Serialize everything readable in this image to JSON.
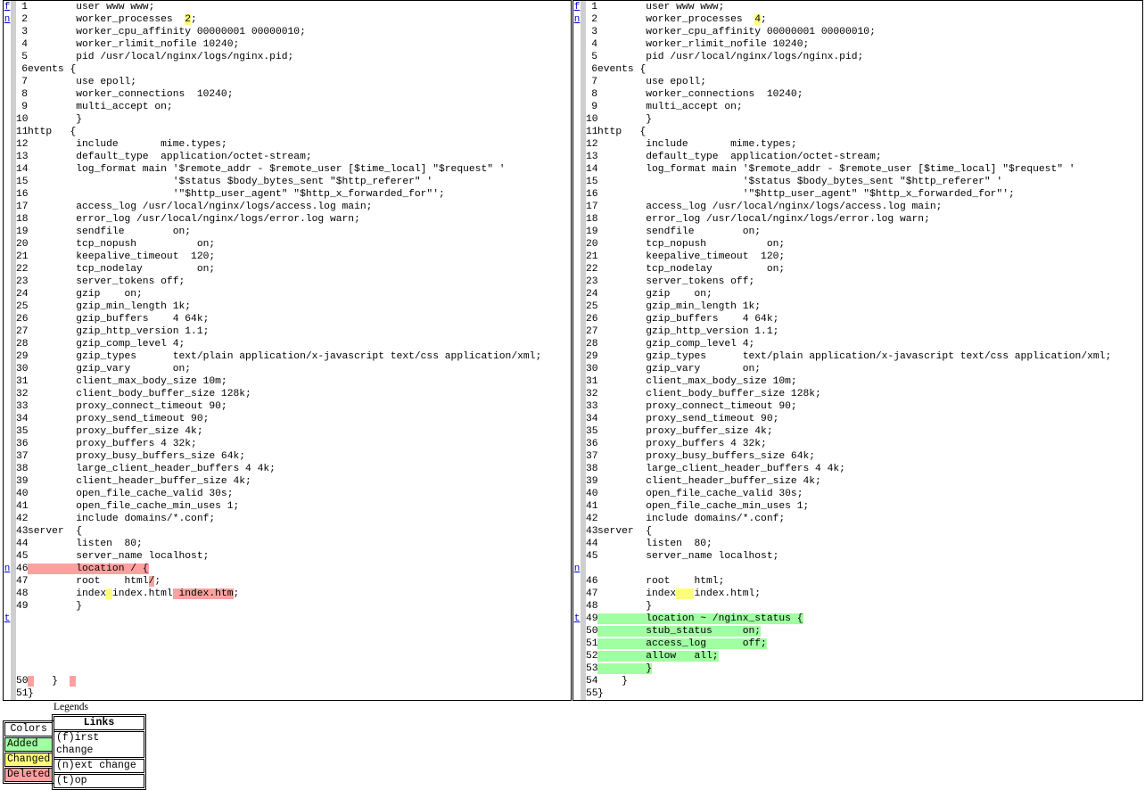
{
  "colors": {
    "added": "#a0ffa0",
    "changed": "#ffff77",
    "deleted": "#ffa0a0",
    "gutter": "#cfcfcf",
    "link": "#0000cc"
  },
  "left_pane": {
    "rows": [
      {
        "num": "1",
        "nav": "f",
        "segs": [
          {
            "t": "        user www www;"
          }
        ]
      },
      {
        "num": "2",
        "nav": "n",
        "segs": [
          {
            "t": "        worker_processes  "
          },
          {
            "t": "2",
            "k": "chg"
          },
          {
            "t": ";"
          }
        ]
      },
      {
        "num": "3",
        "segs": [
          {
            "t": "        worker_cpu_affinity 00000001 00000010;"
          }
        ]
      },
      {
        "num": "4",
        "segs": [
          {
            "t": "        worker_rlimit_nofile 10240;"
          }
        ]
      },
      {
        "num": "5",
        "segs": [
          {
            "t": "        pid /usr/local/nginx/logs/nginx.pid;"
          }
        ]
      },
      {
        "num": "6",
        "segs": [
          {
            "t": "events {"
          }
        ]
      },
      {
        "num": "7",
        "segs": [
          {
            "t": "        use epoll;"
          }
        ]
      },
      {
        "num": "8",
        "segs": [
          {
            "t": "        worker_connections  10240;"
          }
        ]
      },
      {
        "num": "9",
        "segs": [
          {
            "t": "        multi_accept on;"
          }
        ]
      },
      {
        "num": "10",
        "segs": [
          {
            "t": "        }"
          }
        ]
      },
      {
        "num": "11",
        "segs": [
          {
            "t": "http   {"
          }
        ]
      },
      {
        "num": "12",
        "segs": [
          {
            "t": "        include       mime.types;"
          }
        ]
      },
      {
        "num": "13",
        "segs": [
          {
            "t": "        default_type  application/octet-stream;"
          }
        ]
      },
      {
        "num": "14",
        "segs": [
          {
            "t": "        log_format main '$remote_addr - $remote_user [$time_local] \"$request\" '"
          }
        ]
      },
      {
        "num": "15",
        "segs": [
          {
            "t": "                        '$status $body_bytes_sent \"$http_referer\" '"
          }
        ]
      },
      {
        "num": "16",
        "segs": [
          {
            "t": "                        '\"$http_user_agent\" \"$http_x_forwarded_for\"';"
          }
        ]
      },
      {
        "num": "17",
        "segs": [
          {
            "t": "        access_log /usr/local/nginx/logs/access.log main;"
          }
        ]
      },
      {
        "num": "18",
        "segs": [
          {
            "t": "        error_log /usr/local/nginx/logs/error.log warn;"
          }
        ]
      },
      {
        "num": "19",
        "segs": [
          {
            "t": "        sendfile        on;"
          }
        ]
      },
      {
        "num": "20",
        "segs": [
          {
            "t": "        tcp_nopush          on;"
          }
        ]
      },
      {
        "num": "21",
        "segs": [
          {
            "t": "        keepalive_timeout  120;"
          }
        ]
      },
      {
        "num": "22",
        "segs": [
          {
            "t": "        tcp_nodelay         on;"
          }
        ]
      },
      {
        "num": "23",
        "segs": [
          {
            "t": "        server_tokens off;"
          }
        ]
      },
      {
        "num": "24",
        "segs": [
          {
            "t": "        gzip    on;"
          }
        ]
      },
      {
        "num": "25",
        "segs": [
          {
            "t": "        gzip_min_length 1k;"
          }
        ]
      },
      {
        "num": "26",
        "segs": [
          {
            "t": "        gzip_buffers    4 64k;"
          }
        ]
      },
      {
        "num": "27",
        "segs": [
          {
            "t": "        gzip_http_version 1.1;"
          }
        ]
      },
      {
        "num": "28",
        "segs": [
          {
            "t": "        gzip_comp_level 4;"
          }
        ]
      },
      {
        "num": "29",
        "segs": [
          {
            "t": "        gzip_types      text/plain application/x-javascript text/css application/xml;"
          }
        ]
      },
      {
        "num": "30",
        "segs": [
          {
            "t": "        gzip_vary       on;"
          }
        ]
      },
      {
        "num": "31",
        "segs": [
          {
            "t": "        client_max_body_size 10m;"
          }
        ]
      },
      {
        "num": "32",
        "segs": [
          {
            "t": "        client_body_buffer_size 128k;"
          }
        ]
      },
      {
        "num": "33",
        "segs": [
          {
            "t": "        proxy_connect_timeout 90;"
          }
        ]
      },
      {
        "num": "34",
        "segs": [
          {
            "t": "        proxy_send_timeout 90;"
          }
        ]
      },
      {
        "num": "35",
        "segs": [
          {
            "t": "        proxy_buffer_size 4k;"
          }
        ]
      },
      {
        "num": "36",
        "segs": [
          {
            "t": "        proxy_buffers 4 32k;"
          }
        ]
      },
      {
        "num": "37",
        "segs": [
          {
            "t": "        proxy_busy_buffers_size 64k;"
          }
        ]
      },
      {
        "num": "38",
        "segs": [
          {
            "t": "        large_client_header_buffers 4 4k;"
          }
        ]
      },
      {
        "num": "39",
        "segs": [
          {
            "t": "        client_header_buffer_size 4k;"
          }
        ]
      },
      {
        "num": "40",
        "segs": [
          {
            "t": "        open_file_cache_valid 30s;"
          }
        ]
      },
      {
        "num": "41",
        "segs": [
          {
            "t": "        open_file_cache_min_uses 1;"
          }
        ]
      },
      {
        "num": "42",
        "segs": [
          {
            "t": "        include domains/*.conf;"
          }
        ]
      },
      {
        "num": "43",
        "segs": [
          {
            "t": "server  {"
          }
        ]
      },
      {
        "num": "44",
        "segs": [
          {
            "t": "        listen  80;"
          }
        ]
      },
      {
        "num": "45",
        "segs": [
          {
            "t": "        server_name localhost;"
          }
        ]
      },
      {
        "num": "46",
        "nav": "n",
        "segs": [
          {
            "t": "        location / {",
            "k": "del"
          }
        ]
      },
      {
        "num": "47",
        "segs": [
          {
            "t": "        root    html"
          },
          {
            "t": "/",
            "k": "del"
          },
          {
            "t": ";"
          }
        ]
      },
      {
        "num": "48",
        "segs": [
          {
            "t": "        index"
          },
          {
            "t": " ",
            "k": "chg"
          },
          {
            "t": "index.html"
          },
          {
            "t": " index.htm",
            "k": "del"
          },
          {
            "t": ";"
          }
        ]
      },
      {
        "num": "49",
        "segs": [
          {
            "t": "        }"
          }
        ]
      },
      {
        "num": "",
        "nav": "t",
        "segs": []
      },
      {
        "num": "",
        "segs": []
      },
      {
        "num": "",
        "segs": []
      },
      {
        "num": "",
        "segs": []
      },
      {
        "num": "",
        "segs": []
      },
      {
        "num": "50",
        "segs": [
          {
            "t": " ",
            "k": "del"
          },
          {
            "t": "   }  "
          },
          {
            "t": " ",
            "k": "del"
          }
        ]
      },
      {
        "num": "51",
        "segs": [
          {
            "t": "}"
          }
        ]
      }
    ]
  },
  "right_pane": {
    "rows": [
      {
        "num": "1",
        "nav": "f",
        "segs": [
          {
            "t": "        user www www;"
          }
        ]
      },
      {
        "num": "2",
        "nav": "n",
        "segs": [
          {
            "t": "        worker_processes  "
          },
          {
            "t": "4",
            "k": "chg"
          },
          {
            "t": ";"
          }
        ]
      },
      {
        "num": "3",
        "segs": [
          {
            "t": "        worker_cpu_affinity 00000001 00000010;"
          }
        ]
      },
      {
        "num": "4",
        "segs": [
          {
            "t": "        worker_rlimit_nofile 10240;"
          }
        ]
      },
      {
        "num": "5",
        "segs": [
          {
            "t": "        pid /usr/local/nginx/logs/nginx.pid;"
          }
        ]
      },
      {
        "num": "6",
        "segs": [
          {
            "t": "events {"
          }
        ]
      },
      {
        "num": "7",
        "segs": [
          {
            "t": "        use epoll;"
          }
        ]
      },
      {
        "num": "8",
        "segs": [
          {
            "t": "        worker_connections  10240;"
          }
        ]
      },
      {
        "num": "9",
        "segs": [
          {
            "t": "        multi_accept on;"
          }
        ]
      },
      {
        "num": "10",
        "segs": [
          {
            "t": "        }"
          }
        ]
      },
      {
        "num": "11",
        "segs": [
          {
            "t": "http   {"
          }
        ]
      },
      {
        "num": "12",
        "segs": [
          {
            "t": "        include       mime.types;"
          }
        ]
      },
      {
        "num": "13",
        "segs": [
          {
            "t": "        default_type  application/octet-stream;"
          }
        ]
      },
      {
        "num": "14",
        "segs": [
          {
            "t": "        log_format main '$remote_addr - $remote_user [$time_local] \"$request\" '"
          }
        ]
      },
      {
        "num": "15",
        "segs": [
          {
            "t": "                        '$status $body_bytes_sent \"$http_referer\" '"
          }
        ]
      },
      {
        "num": "16",
        "segs": [
          {
            "t": "                        '\"$http_user_agent\" \"$http_x_forwarded_for\"';"
          }
        ]
      },
      {
        "num": "17",
        "segs": [
          {
            "t": "        access_log /usr/local/nginx/logs/access.log main;"
          }
        ]
      },
      {
        "num": "18",
        "segs": [
          {
            "t": "        error_log /usr/local/nginx/logs/error.log warn;"
          }
        ]
      },
      {
        "num": "19",
        "segs": [
          {
            "t": "        sendfile        on;"
          }
        ]
      },
      {
        "num": "20",
        "segs": [
          {
            "t": "        tcp_nopush          on;"
          }
        ]
      },
      {
        "num": "21",
        "segs": [
          {
            "t": "        keepalive_timeout  120;"
          }
        ]
      },
      {
        "num": "22",
        "segs": [
          {
            "t": "        tcp_nodelay         on;"
          }
        ]
      },
      {
        "num": "23",
        "segs": [
          {
            "t": "        server_tokens off;"
          }
        ]
      },
      {
        "num": "24",
        "segs": [
          {
            "t": "        gzip    on;"
          }
        ]
      },
      {
        "num": "25",
        "segs": [
          {
            "t": "        gzip_min_length 1k;"
          }
        ]
      },
      {
        "num": "26",
        "segs": [
          {
            "t": "        gzip_buffers    4 64k;"
          }
        ]
      },
      {
        "num": "27",
        "segs": [
          {
            "t": "        gzip_http_version 1.1;"
          }
        ]
      },
      {
        "num": "28",
        "segs": [
          {
            "t": "        gzip_comp_level 4;"
          }
        ]
      },
      {
        "num": "29",
        "segs": [
          {
            "t": "        gzip_types      text/plain application/x-javascript text/css application/xml;"
          }
        ]
      },
      {
        "num": "30",
        "segs": [
          {
            "t": "        gzip_vary       on;"
          }
        ]
      },
      {
        "num": "31",
        "segs": [
          {
            "t": "        client_max_body_size 10m;"
          }
        ]
      },
      {
        "num": "32",
        "segs": [
          {
            "t": "        client_body_buffer_size 128k;"
          }
        ]
      },
      {
        "num": "33",
        "segs": [
          {
            "t": "        proxy_connect_timeout 90;"
          }
        ]
      },
      {
        "num": "34",
        "segs": [
          {
            "t": "        proxy_send_timeout 90;"
          }
        ]
      },
      {
        "num": "35",
        "segs": [
          {
            "t": "        proxy_buffer_size 4k;"
          }
        ]
      },
      {
        "num": "36",
        "segs": [
          {
            "t": "        proxy_buffers 4 32k;"
          }
        ]
      },
      {
        "num": "37",
        "segs": [
          {
            "t": "        proxy_busy_buffers_size 64k;"
          }
        ]
      },
      {
        "num": "38",
        "segs": [
          {
            "t": "        large_client_header_buffers 4 4k;"
          }
        ]
      },
      {
        "num": "39",
        "segs": [
          {
            "t": "        client_header_buffer_size 4k;"
          }
        ]
      },
      {
        "num": "40",
        "segs": [
          {
            "t": "        open_file_cache_valid 30s;"
          }
        ]
      },
      {
        "num": "41",
        "segs": [
          {
            "t": "        open_file_cache_min_uses 1;"
          }
        ]
      },
      {
        "num": "42",
        "segs": [
          {
            "t": "        include domains/*.conf;"
          }
        ]
      },
      {
        "num": "43",
        "segs": [
          {
            "t": "server  {"
          }
        ]
      },
      {
        "num": "44",
        "segs": [
          {
            "t": "        listen  80;"
          }
        ]
      },
      {
        "num": "45",
        "segs": [
          {
            "t": "        server_name localhost;"
          }
        ]
      },
      {
        "num": "",
        "nav": "n",
        "segs": []
      },
      {
        "num": "46",
        "segs": [
          {
            "t": "        root    html;"
          }
        ]
      },
      {
        "num": "47",
        "segs": [
          {
            "t": "        index"
          },
          {
            "t": "   ",
            "k": "chg"
          },
          {
            "t": "index.html;"
          }
        ]
      },
      {
        "num": "48",
        "segs": [
          {
            "t": "        }"
          }
        ]
      },
      {
        "num": "49",
        "nav": "t",
        "segs": [
          {
            "t": "        location ~ /nginx_status {",
            "k": "add",
            "full": true
          }
        ]
      },
      {
        "num": "50",
        "segs": [
          {
            "t": "        stub_status     on;",
            "k": "add",
            "full": true
          }
        ]
      },
      {
        "num": "51",
        "segs": [
          {
            "t": "        access_log      off;",
            "k": "add",
            "full": true
          }
        ]
      },
      {
        "num": "52",
        "segs": [
          {
            "t": "        allow   all;",
            "k": "add",
            "full": true
          }
        ]
      },
      {
        "num": "53",
        "segs": [
          {
            "t": "        }",
            "k": "add",
            "full": true
          }
        ]
      },
      {
        "num": "54",
        "segs": [
          {
            "t": "    }"
          }
        ]
      },
      {
        "num": "55",
        "segs": [
          {
            "t": "}"
          }
        ]
      }
    ]
  },
  "legend": {
    "title": "Legends",
    "colors_header": "Colors",
    "added": "Added",
    "changed": "Changed",
    "deleted": "Deleted",
    "links_header": "Links",
    "first_change": "(f)irst change",
    "next_change": "(n)ext change",
    "top": "(t)op"
  }
}
